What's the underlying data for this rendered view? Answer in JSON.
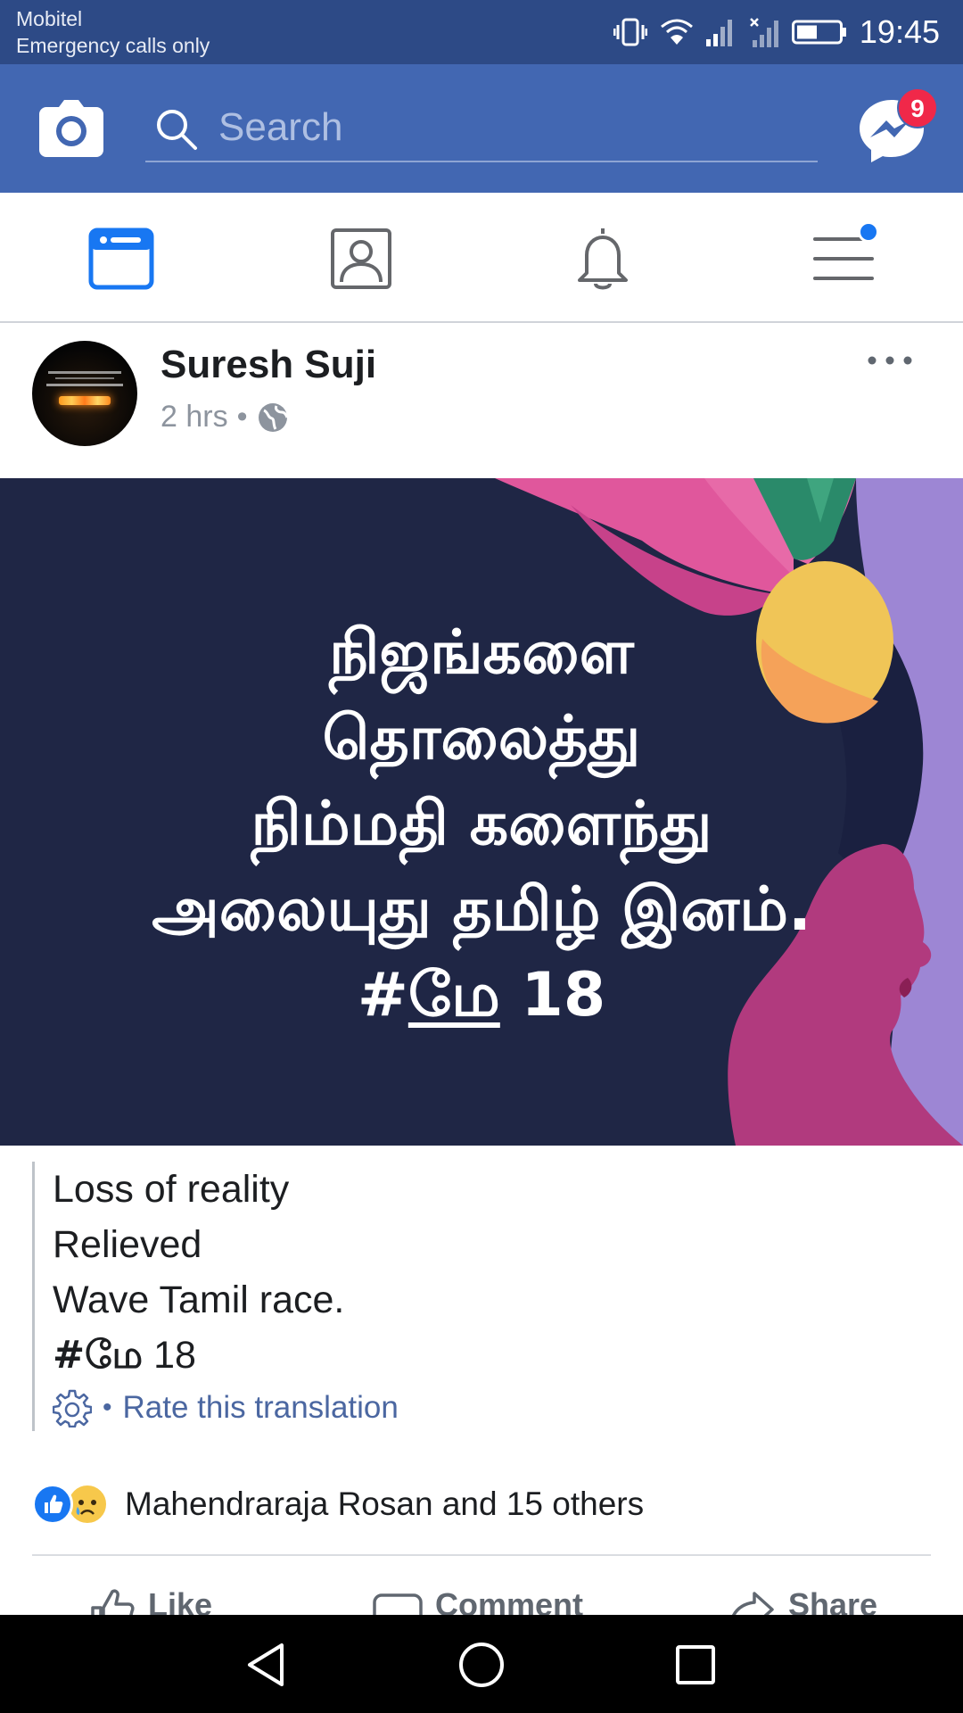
{
  "status_bar": {
    "carrier": "Mobitel",
    "carrier_status": "Emergency calls only",
    "time": "19:45",
    "icons": [
      "vibrate-icon",
      "wifi-icon",
      "signal-icon",
      "no-signal-icon",
      "battery-icon"
    ]
  },
  "header": {
    "search_placeholder": "Search",
    "messenger_badge": "9",
    "icons": [
      "camera-icon",
      "search-icon",
      "messenger-icon"
    ]
  },
  "tabs": [
    {
      "name": "news-feed",
      "icon": "news-feed-icon",
      "active": true
    },
    {
      "name": "profile",
      "icon": "profile-icon",
      "active": false
    },
    {
      "name": "notifications",
      "icon": "bell-icon",
      "active": false
    },
    {
      "name": "menu",
      "icon": "menu-icon",
      "active": false
    }
  ],
  "post": {
    "author": "Suresh Suji",
    "time": "2 hrs",
    "separator": "•",
    "privacy_icon": "globe-icon",
    "image_text_lines": [
      "நிஜங்களை",
      "தொலைத்து",
      "நிம்மதி களைந்து",
      "அலையுது தமிழ் இனம்."
    ],
    "image_hashtag_prefix": "#",
    "image_hashtag_word": "மே",
    "image_hashtag_suffix": " 18",
    "translation": {
      "lines": [
        "Loss of reality",
        "Relieved",
        "Wave Tamil race."
      ],
      "hashtag_bold": "#மே",
      "hashtag_rest": " 18",
      "rate_separator": "•",
      "rate_label": "Rate this translation"
    },
    "reactions_text": "Mahendraraja Rosan and 15 others",
    "actions": {
      "like": "Like",
      "comment": "Comment",
      "share": "Share"
    }
  },
  "colors": {
    "status_bar": "#2d4a86",
    "header": "#4267b2",
    "accent": "#1877f2",
    "badge": "#f02849",
    "image_bg": "#1f2645",
    "image_pink": "#e0579c",
    "image_lavender": "#9d86d4",
    "image_yellow": "#f0c557",
    "image_orange": "#f5a259",
    "image_magenta": "#b13a7e",
    "image_green": "#2a8a6a"
  }
}
